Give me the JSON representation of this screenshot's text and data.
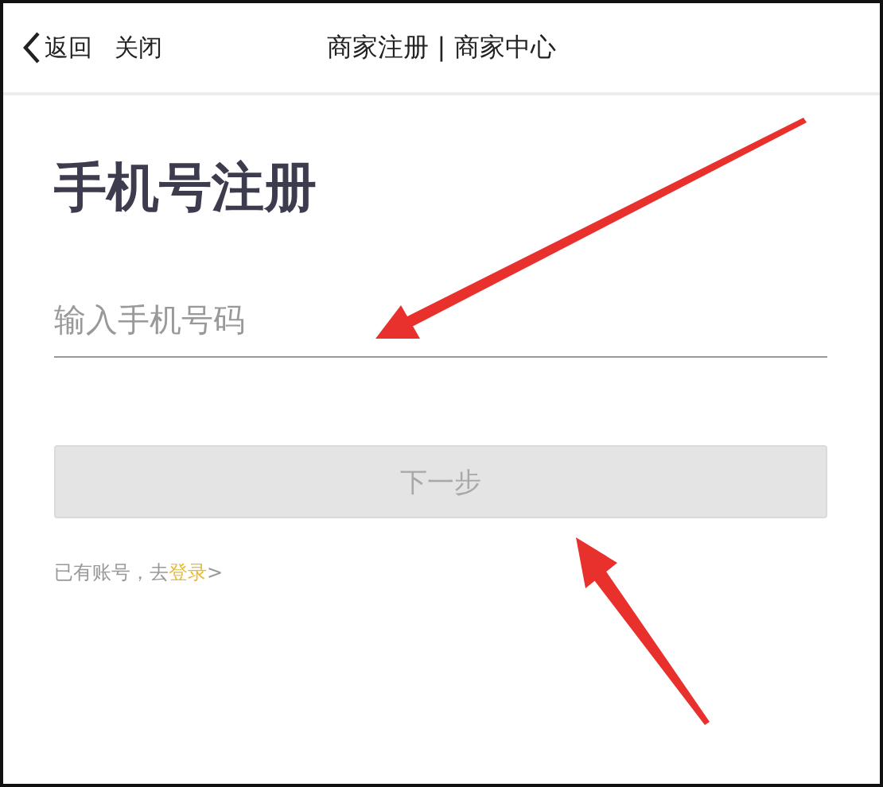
{
  "nav_bar": {
    "back": "返回",
    "close": "关闭",
    "title": "商家注册 | 商家中心"
  },
  "heading": "手机号注册",
  "phone_field": {
    "placeholder": "输入手机号码"
  },
  "next_button": {
    "label": "下一步",
    "disabled": true
  },
  "login_prompt": {
    "text": "已有账号，去",
    "link": "登录",
    "suffix": ">"
  }
}
